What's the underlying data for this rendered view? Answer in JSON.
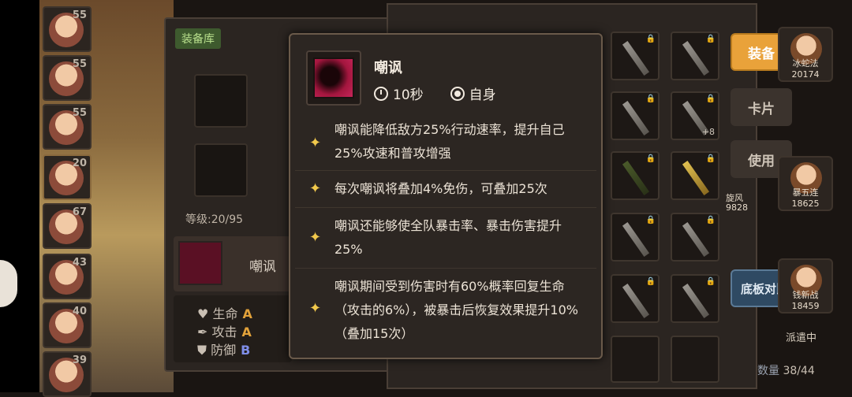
{
  "heroes_left": [
    {
      "level": "55"
    },
    {
      "level": "55"
    },
    {
      "level": "55"
    },
    {
      "level": "20"
    },
    {
      "level": "67"
    },
    {
      "level": "43"
    },
    {
      "level": "40"
    },
    {
      "level": "39"
    }
  ],
  "equip_panel": {
    "tab_label": "装备库",
    "level_text": "等级:20/95",
    "skill_name": "嘲讽",
    "stats": [
      {
        "name": "生命",
        "grade": "A"
      },
      {
        "name": "攻击",
        "grade": "A"
      },
      {
        "name": "防御",
        "grade": "B"
      }
    ]
  },
  "right_buttons": {
    "equip": "装备",
    "card": "卡片",
    "use": "使用",
    "compare": "底板对比"
  },
  "right_heroes": [
    {
      "name": "冰蛇法",
      "power": "20174"
    },
    {
      "name": "暴五连",
      "power": "18625"
    },
    {
      "name": "钱新战",
      "power": "18459"
    }
  ],
  "partial_texts": {
    "wind": "旋风",
    "wind_power": "9828",
    "dispatch": "派遣中"
  },
  "grid_plus": "+8",
  "count": {
    "label": "数量",
    "value": "38/44"
  },
  "tooltip": {
    "title": "嘲讽",
    "duration": "10秒",
    "target": "自身",
    "effects": [
      "嘲讽能降低敌方25%行动速率，提升自己25%攻速和普攻增强",
      "每次嘲讽将叠加4%免伤，可叠加25次",
      "嘲讽还能够使全队暴击率、暴击伤害提升25%",
      "嘲讽期间受到伤害时有60%概率回复生命（攻击的6%），被暴击后恢复效果提升10%（叠加15次）"
    ]
  },
  "colors": {
    "accent": "#e8a23a",
    "grade_b": "#7f8ee8",
    "star": "#f2c94c",
    "skill_red": "#a3163e"
  }
}
